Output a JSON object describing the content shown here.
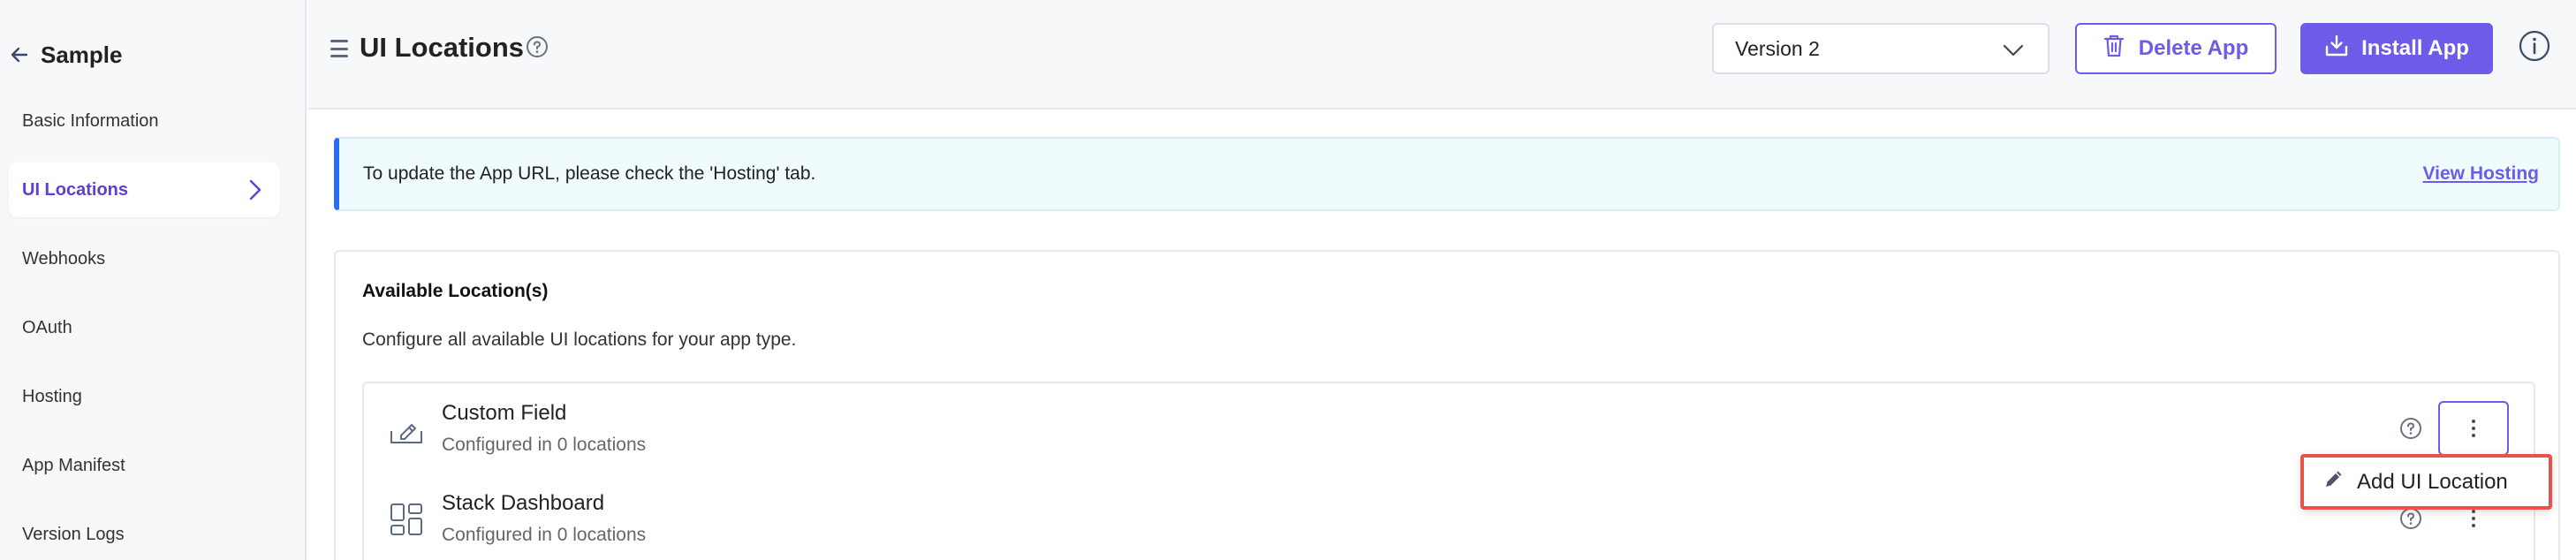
{
  "sidebar": {
    "app_name": "Sample",
    "items": [
      {
        "label": "Basic Information",
        "active": false
      },
      {
        "label": "UI Locations",
        "active": true
      },
      {
        "label": "Webhooks",
        "active": false
      },
      {
        "label": "OAuth",
        "active": false
      },
      {
        "label": "Hosting",
        "active": false
      },
      {
        "label": "App Manifest",
        "active": false
      },
      {
        "label": "Version Logs",
        "active": false
      }
    ]
  },
  "header": {
    "title": "UI Locations",
    "version_value": "Version 2",
    "delete_label": "Delete App",
    "install_label": "Install App"
  },
  "banner": {
    "text": "To update the App URL, please check the 'Hosting' tab.",
    "link": "View Hosting"
  },
  "locations": {
    "title": "Available Location(s)",
    "description": "Configure all available UI locations for your app type.",
    "rows": [
      {
        "name": "Custom Field",
        "sub": "Configured in 0 locations",
        "icon": "custom-field-icon"
      },
      {
        "name": "Stack Dashboard",
        "sub": "Configured in 0 locations",
        "icon": "dashboard-icon"
      }
    ]
  },
  "dropdown": {
    "add_label": "Add UI Location"
  },
  "colors": {
    "accent": "#6c5ce7",
    "banner_border": "#2a6df4",
    "highlight": "#e8544a"
  }
}
